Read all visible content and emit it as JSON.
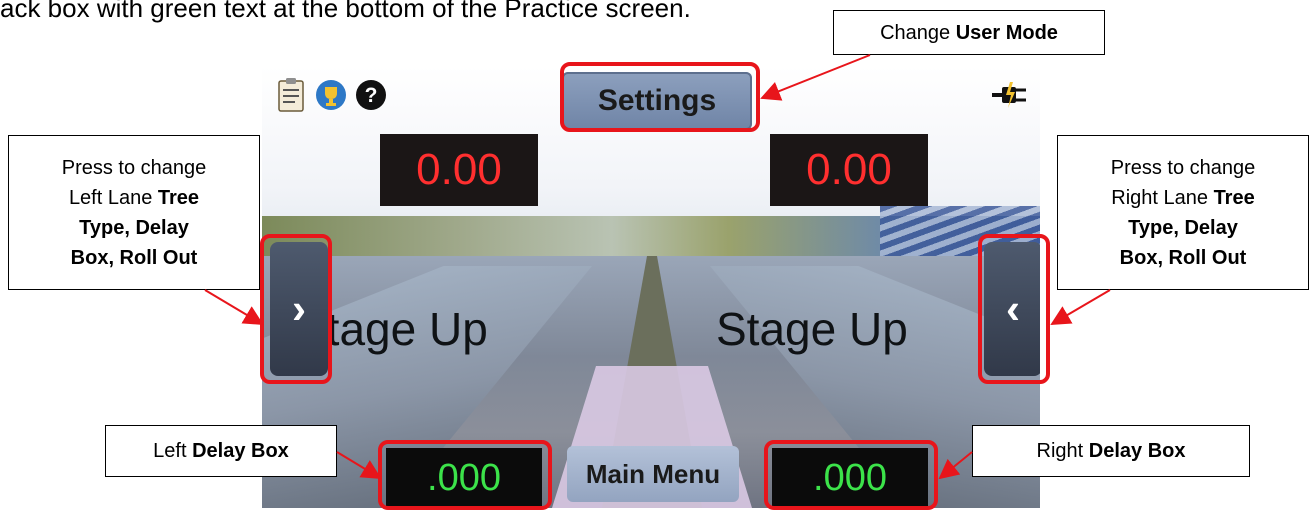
{
  "caption": "ack box with green text at the bottom of the Practice screen.",
  "screen": {
    "settings_label": "Settings",
    "left_timer": "0.00",
    "right_timer": "0.00",
    "left_stage": "Stage Up",
    "right_stage": "Stage Up",
    "left_arrow_glyph": "›",
    "right_arrow_glyph": "‹",
    "left_delay": ".000",
    "right_delay": ".000",
    "main_menu_label": "Main Menu",
    "icons": [
      "clipboard-icon",
      "trophy-icon",
      "help-icon",
      "power-plug-icon"
    ]
  },
  "callouts": {
    "user_mode": {
      "plain": "Change ",
      "bold": "User Mode"
    },
    "left_lane": {
      "line1": "Press to change",
      "line2_plain": "Left Lane ",
      "line2_bold": "Tree",
      "line3_bold": "Type, Delay",
      "line4_bold": "Box, Roll Out"
    },
    "right_lane": {
      "line1": "Press to change",
      "line2_plain": "Right Lane ",
      "line2_bold": "Tree",
      "line3_bold": "Type, Delay",
      "line4_bold": "Box, Roll Out"
    },
    "left_delay": {
      "plain": "Left ",
      "bold": "Delay Box"
    },
    "right_delay": {
      "plain": "Right ",
      "bold": "Delay Box"
    }
  },
  "colors": {
    "highlight": "#e8151b",
    "timer_text": "#ff2f2f",
    "delay_text": "#3ce34a"
  }
}
